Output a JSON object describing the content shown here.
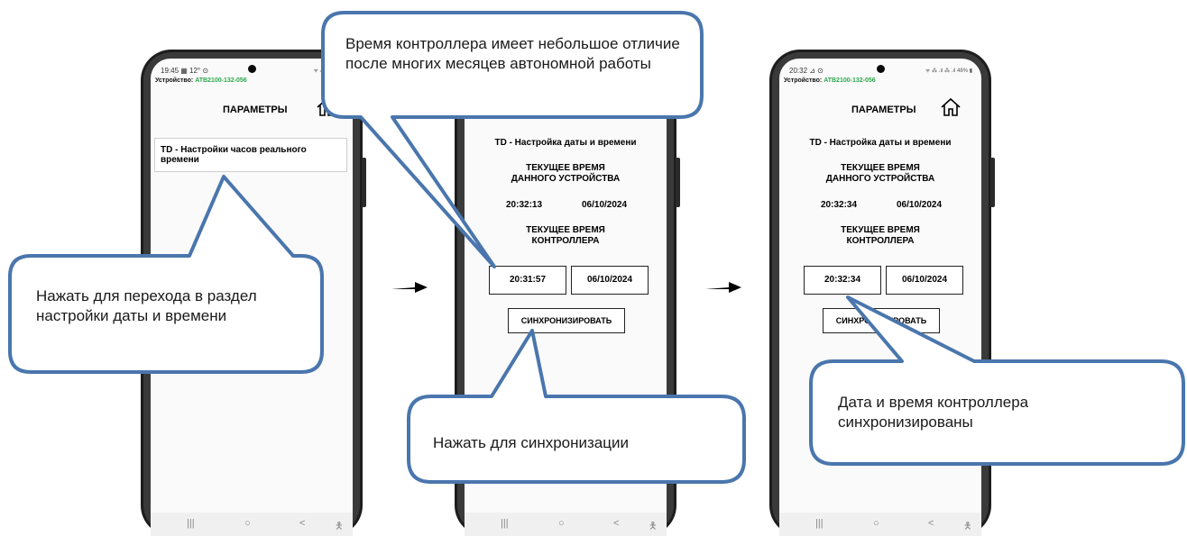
{
  "screens": [
    {
      "status_time": "19:45 ▦ 12° ⊙",
      "status_icons": "ᯤ ⁂ .ıl ⁂ .ıl",
      "device_label": "Устройство:",
      "device_id": "ATB2100-132-056",
      "header_title": "ПАРАМЕТРЫ",
      "menu_item": "TD - Настройки часов реального времени"
    },
    {
      "section_title": "TD - Настройка даты и времени",
      "device_time_label_1": "ТЕКУЩЕЕ ВРЕМЯ",
      "device_time_label_2": "ДАННОГО УСТРОЙСТВА",
      "device_time": "20:32:13",
      "device_date": "06/10/2024",
      "controller_label_1": "ТЕКУЩЕЕ ВРЕМЯ",
      "controller_label_2": "КОНТРОЛЛЕРА",
      "controller_time": "20:31:57",
      "controller_date": "06/10/2024",
      "sync_button": "СИНХРОНИЗИРОВАТЬ"
    },
    {
      "status_time": "20:32 ⊿ ⊙",
      "status_icons": "ᯤ ⁂ .ıl ⁂ .ıl 48% ▮",
      "device_label": "Устройство:",
      "device_id": "ATB2100-132-056",
      "header_title": "ПАРАМЕТРЫ",
      "section_title": "TD - Настройка даты и времени",
      "device_time_label_1": "ТЕКУЩЕЕ ВРЕМЯ",
      "device_time_label_2": "ДАННОГО УСТРОЙСТВА",
      "device_time": "20:32:34",
      "device_date": "06/10/2024",
      "controller_label_1": "ТЕКУЩЕЕ ВРЕМЯ",
      "controller_label_2": "КОНТРОЛЛЕРА",
      "controller_time": "20:32:34",
      "controller_date": "06/10/2024",
      "sync_button": "СИНХРОНИЗИРОВАТЬ"
    }
  ],
  "nav": {
    "recents": "|||",
    "home": "○",
    "back": "<",
    "accessibility": "🯅"
  },
  "callouts": {
    "top": "Время контроллера имеет небольшое отличие после многих месяцев автономной работы",
    "left": "Нажать для перехода в раздел настройки даты и времени",
    "middle": "Нажать для синхронизации",
    "right": "Дата и время контроллера синхронизированы"
  },
  "colors": {
    "callout_border": "#4a76ad",
    "accent_green": "#2aa84a"
  }
}
